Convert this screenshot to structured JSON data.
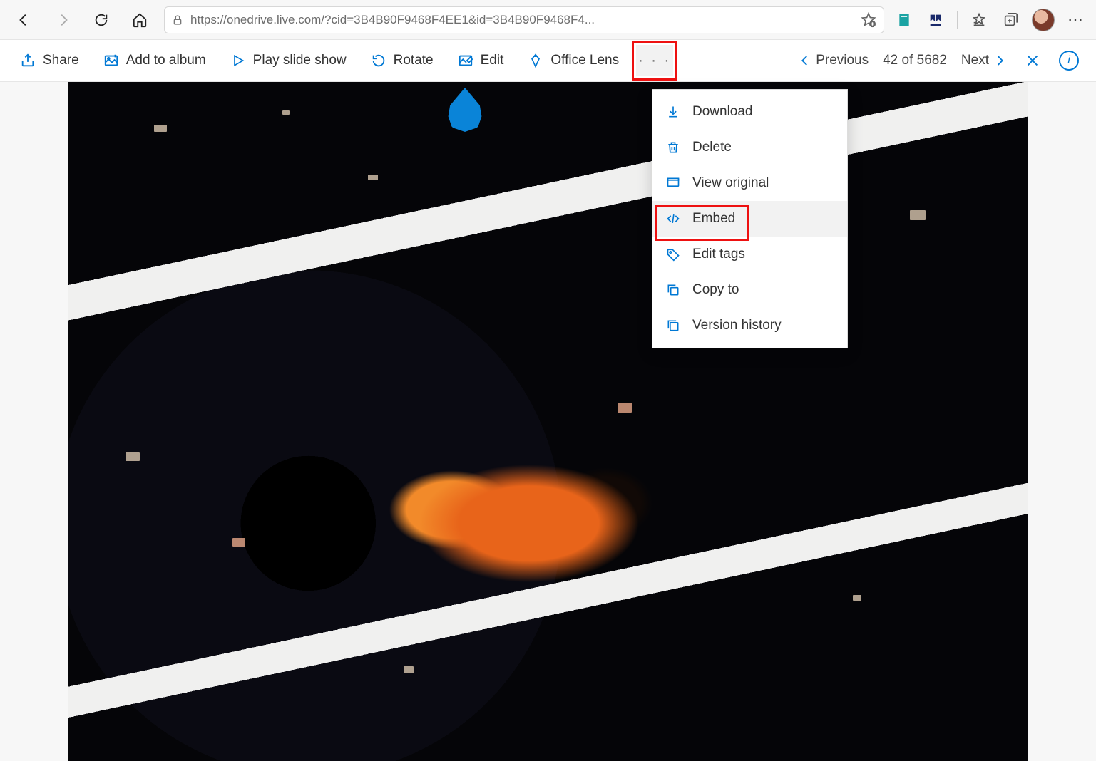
{
  "browser": {
    "url": "https://onedrive.live.com/?cid=3B4B90F9468F4EE1&id=3B4B90F9468F4..."
  },
  "commands": {
    "share": "Share",
    "add_to_album": "Add to album",
    "play_slideshow": "Play slide show",
    "rotate": "Rotate",
    "edit": "Edit",
    "office_lens": "Office Lens"
  },
  "nav": {
    "previous": "Previous",
    "count": "42 of 5682",
    "next": "Next"
  },
  "menu": {
    "download": "Download",
    "delete": "Delete",
    "view_original": "View original",
    "embed": "Embed",
    "edit_tags": "Edit tags",
    "copy_to": "Copy to",
    "version_history": "Version history"
  }
}
